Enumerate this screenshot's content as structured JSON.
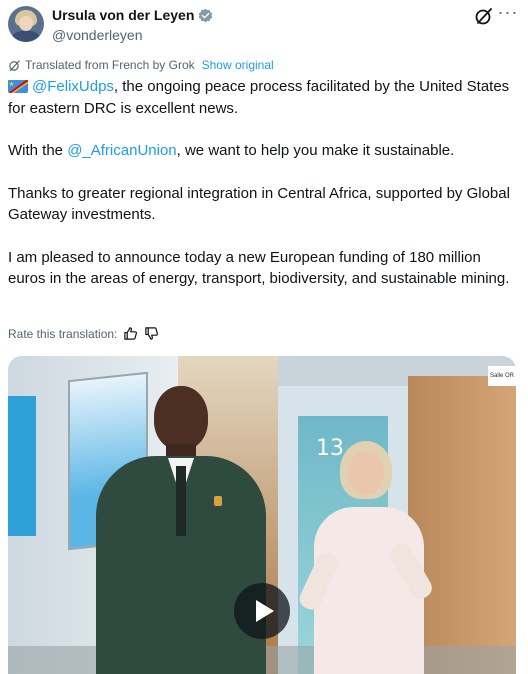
{
  "author": {
    "display_name": "Ursula von der Leyen",
    "handle": "@vonderleyen",
    "verified_icon": "verified-badge-icon"
  },
  "header_actions": {
    "grok_icon": "grok-icon",
    "more_label": "···"
  },
  "translation": {
    "notice": "Translated from French by Grok",
    "show_original": "Show original",
    "rate_label": "Rate this translation:"
  },
  "tweet": {
    "p1_mention": "@FelixUdps",
    "p1_rest": ", the ongoing peace process facilitated by the United States for eastern DRC is excellent news.",
    "p2_prefix": "With the ",
    "p2_mention": "@_AfricanUnion",
    "p2_rest": ", we want to help you make it sustainable.",
    "p3": "Thanks to greater regional integration in Central Africa, supported by Global Gateway investments.",
    "p4": "I am pleased to announce today a new European funding of 180 million euros in the areas of energy, transport, biodiversity, and sustainable mining."
  },
  "media": {
    "room_number": "13",
    "sign_text": "Salle OR",
    "play_icon": "play-icon"
  },
  "colors": {
    "link": "#1d9bf0",
    "secondary_text": "#536471",
    "primary_text": "#0f1419"
  }
}
